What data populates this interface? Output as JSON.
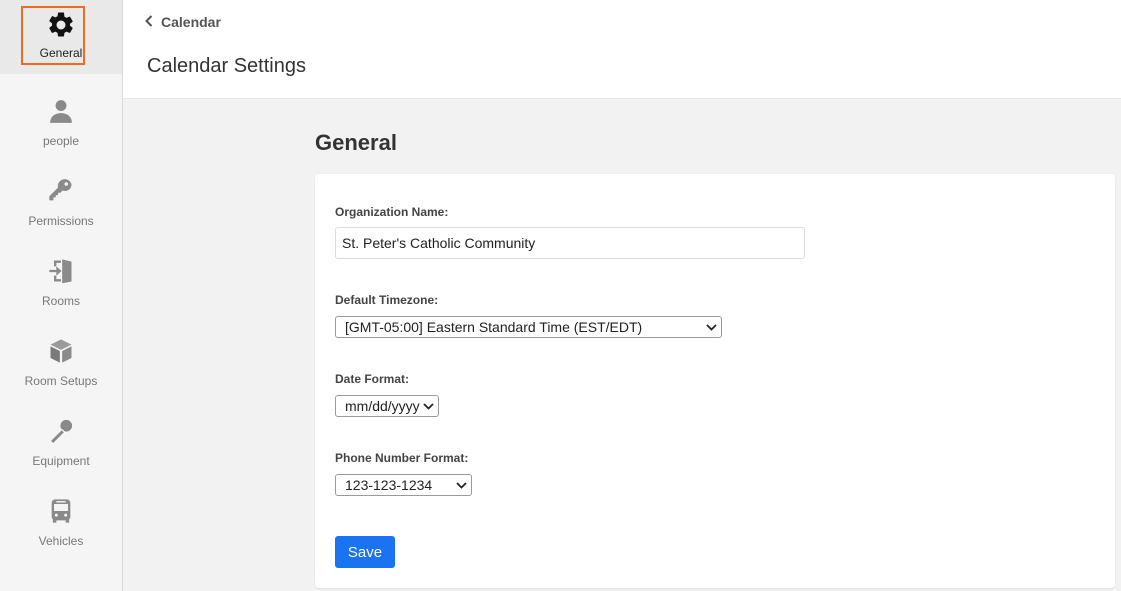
{
  "sidebar": {
    "items": [
      {
        "label": "General",
        "icon": "gear-icon",
        "active": true
      },
      {
        "label": "people",
        "icon": "person-icon"
      },
      {
        "label": "Permissions",
        "icon": "key-icon"
      },
      {
        "label": "Rooms",
        "icon": "door-enter-icon"
      },
      {
        "label": "Room Setups",
        "icon": "cube-icon"
      },
      {
        "label": "Equipment",
        "icon": "microphone-icon"
      },
      {
        "label": "Vehicles",
        "icon": "bus-icon"
      }
    ]
  },
  "header": {
    "back_label": "Calendar",
    "title": "Calendar Settings"
  },
  "main": {
    "section_title": "General",
    "form": {
      "org_name_label": "Organization Name:",
      "org_name_value": "St. Peter's Catholic Community",
      "timezone_label": "Default Timezone:",
      "timezone_value": "[GMT-05:00] Eastern Standard Time (EST/EDT)",
      "date_format_label": "Date Format:",
      "date_format_value": "mm/dd/yyyy",
      "phone_format_label": "Phone Number Format:",
      "phone_format_value": "123-123-1234",
      "save_label": "Save"
    }
  },
  "colors": {
    "active_outline": "#ee6c1f",
    "primary_button": "#1a73f0",
    "icon_gray": "#8a8a8a"
  }
}
